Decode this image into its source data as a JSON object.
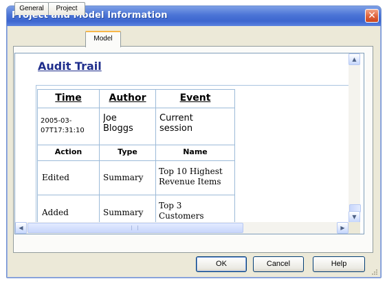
{
  "window": {
    "title": "Project and Model Information",
    "close_glyph": "✕"
  },
  "tabs": [
    {
      "label": "General",
      "active": false
    },
    {
      "label": "Project",
      "active": false
    },
    {
      "label": "Model",
      "active": true
    }
  ],
  "report": {
    "title": "Audit Trail",
    "header": {
      "columns": [
        "Time",
        "Author",
        "Event"
      ],
      "row": {
        "time": "2005-03-07T17:31:10",
        "time_line1": "2005-03-",
        "time_line2": "07T17:31:10",
        "author_line1": "Joe",
        "author_line2": "Bloggs",
        "event_line1": "Current",
        "event_line2": "session"
      }
    },
    "details": {
      "columns": [
        "Action",
        "Type",
        "Name"
      ],
      "rows": [
        {
          "action": "Edited",
          "type": "Summary",
          "name_line1": "Top 10 Highest",
          "name_line2": "Revenue Items"
        },
        {
          "action": "Added",
          "type": "Summary",
          "name_line1": "Top 3",
          "name_line2": "Customers"
        }
      ]
    }
  },
  "scrollbars": {
    "up_glyph": "▲",
    "down_glyph": "▼",
    "left_glyph": "◀",
    "right_glyph": "▶"
  },
  "buttons": {
    "ok": "OK",
    "cancel": "Cancel",
    "help": "Help"
  },
  "colors": {
    "titlebar": "#3d66cf",
    "dialog_bg": "#ece9d8",
    "report_title": "#1f2e8c",
    "table_border": "#9bbad8",
    "active_tab_accent": "#f8b748"
  }
}
